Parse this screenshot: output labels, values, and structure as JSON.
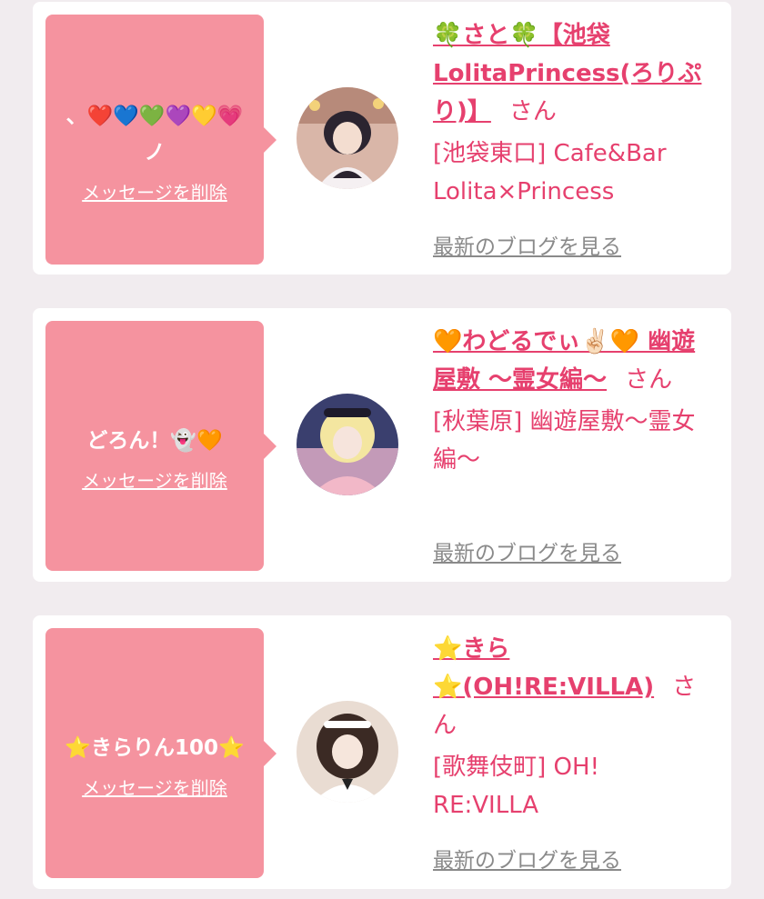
{
  "messages": [
    {
      "message": "、❤️💙💚💜💛💗ノ",
      "delete_label": "メッセージを削除",
      "name": "🍀さと🍀【池袋LolitaPrincess(ろりぷり)】",
      "suffix": "さん",
      "shop": "[池袋東口] Cafe&Bar Lolita×Princess",
      "blog_label": "最新のブログを見る"
    },
    {
      "message": "どろん！👻🧡",
      "delete_label": "メッセージを削除",
      "name": "🧡わどるでぃ✌🏻🧡 幽遊屋敷 〜霊女編〜",
      "suffix": "さん",
      "shop": "[秋葉原] 幽遊屋敷〜霊女編〜",
      "blog_label": "最新のブログを見る"
    },
    {
      "message": "⭐きらりん100⭐",
      "delete_label": "メッセージを削除",
      "name": "⭐きら⭐(OH!RE:VILLA)",
      "suffix": "さん",
      "shop": "[歌舞伎町] OH! RE:VILLA",
      "blog_label": "最新のブログを見る"
    }
  ],
  "colors": {
    "bubble": "#f5939f",
    "accent": "#e6406e",
    "link_gray": "#8a8a8a",
    "background": "#f1ecef"
  }
}
